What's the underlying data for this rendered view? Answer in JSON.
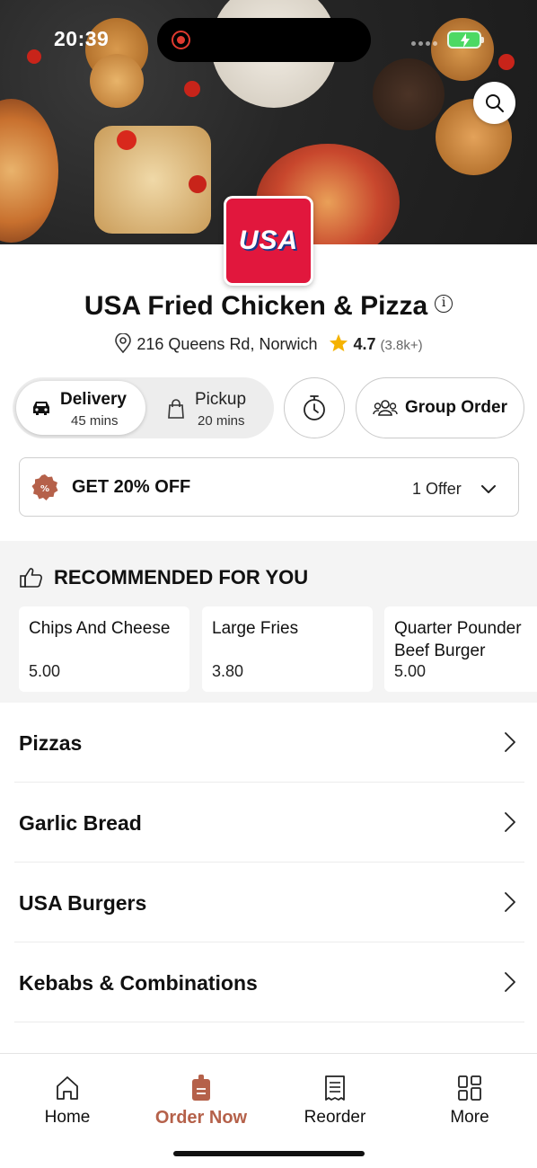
{
  "status_bar": {
    "time": "20:39"
  },
  "restaurant": {
    "logo_text": "USA",
    "name": "USA Fried Chicken & Pizza",
    "address": "216 Queens Rd, Norwich",
    "rating": "4.7",
    "rating_count": "(3.8k+)"
  },
  "order_mode": {
    "delivery": {
      "label": "Delivery",
      "time": "45 mins"
    },
    "pickup": {
      "label": "Pickup",
      "time": "20 mins"
    },
    "selected": "delivery",
    "group_order_label": "Group Order"
  },
  "offer": {
    "title": "GET 20% OFF",
    "count": "1 Offer"
  },
  "recommended": {
    "title": "RECOMMENDED FOR YOU",
    "items": [
      {
        "name": "Chips And Cheese",
        "price": "5.00"
      },
      {
        "name": "Large Fries",
        "price": "3.80"
      },
      {
        "name": "Quarter Pounder Beef Burger Wit...",
        "price": "5.00"
      }
    ]
  },
  "categories": [
    {
      "label": "Pizzas"
    },
    {
      "label": "Garlic Bread"
    },
    {
      "label": "USA Burgers"
    },
    {
      "label": "Kebabs & Combinations"
    }
  ],
  "tabs": [
    {
      "label": "Home",
      "icon": "home-icon"
    },
    {
      "label": "Order Now",
      "icon": "order-bag-icon",
      "active": true
    },
    {
      "label": "Reorder",
      "icon": "receipt-icon"
    },
    {
      "label": "More",
      "icon": "grid-icon"
    }
  ],
  "colors": {
    "accent": "#b5614a",
    "logo_bg": "#e1173d",
    "star": "#f5b301"
  }
}
